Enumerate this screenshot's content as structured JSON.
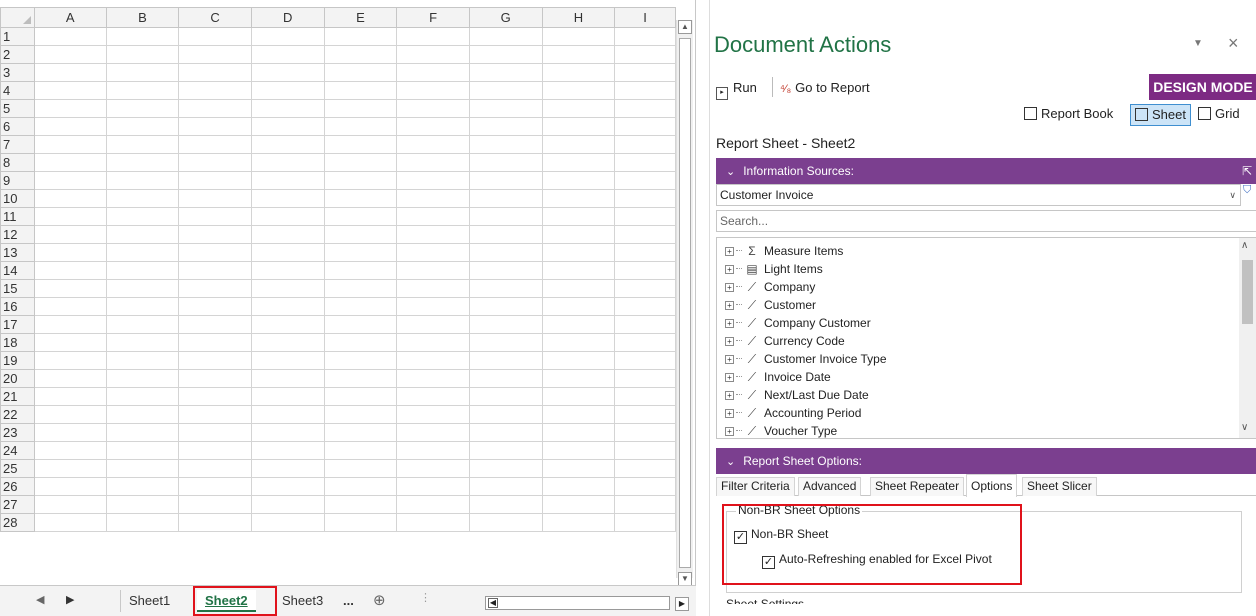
{
  "spreadsheet": {
    "columns": [
      "A",
      "B",
      "C",
      "D",
      "E",
      "F",
      "G",
      "H",
      "I"
    ],
    "rows": [
      "1",
      "2",
      "3",
      "4",
      "5",
      "6",
      "7",
      "8",
      "9",
      "10",
      "11",
      "12",
      "13",
      "14",
      "15",
      "16",
      "17",
      "18",
      "19",
      "20",
      "21",
      "22",
      "23",
      "24",
      "25",
      "26",
      "27",
      "28"
    ],
    "tabs": [
      "Sheet1",
      "Sheet2",
      "Sheet3"
    ],
    "active_tab": "Sheet2",
    "more_tabs": "...",
    "add_sheet": "⊕"
  },
  "pane": {
    "title": "Document Actions",
    "dropdown_glyph": "▼",
    "close_glyph": "×",
    "toolbar": {
      "run_label": "Run",
      "go_to_report_label": "Go to Report",
      "design_mode_label": "DESIGN MODE"
    },
    "views": {
      "report_book_label": "Report Book",
      "sheet_label": "Sheet",
      "grid_label": "Grid"
    },
    "report_sheet_label": "Report Sheet - Sheet2",
    "info_sources": {
      "header": "Information Sources:",
      "selected": "Customer Invoice",
      "search_placeholder": "Search...",
      "items": [
        {
          "label": "Measure Items",
          "icon": "Σ"
        },
        {
          "label": "Light Items",
          "icon": "▤"
        },
        {
          "label": "Company",
          "icon": "⟋"
        },
        {
          "label": "Customer",
          "icon": "⟋"
        },
        {
          "label": "Company Customer",
          "icon": "⟋"
        },
        {
          "label": "Currency Code",
          "icon": "⟋"
        },
        {
          "label": "Customer Invoice Type",
          "icon": "⟋"
        },
        {
          "label": "Invoice Date",
          "icon": "⟋"
        },
        {
          "label": "Next/Last Due Date",
          "icon": "⟋"
        },
        {
          "label": "Accounting Period",
          "icon": "⟋"
        },
        {
          "label": "Voucher Type",
          "icon": "⟋"
        }
      ]
    },
    "sheet_options": {
      "header": "Report Sheet Options:",
      "tabs": [
        "Filter Criteria",
        "Advanced",
        "Sheet Repeater",
        "Options",
        "Sheet Slicer"
      ],
      "active_tab": "Options",
      "group_legend": "Non-BR Sheet Options",
      "non_br_sheet_label": "Non-BR Sheet",
      "auto_refresh_label": "Auto-Refreshing enabled for Excel Pivot",
      "next_group_legend": "Sheet Settings"
    }
  }
}
